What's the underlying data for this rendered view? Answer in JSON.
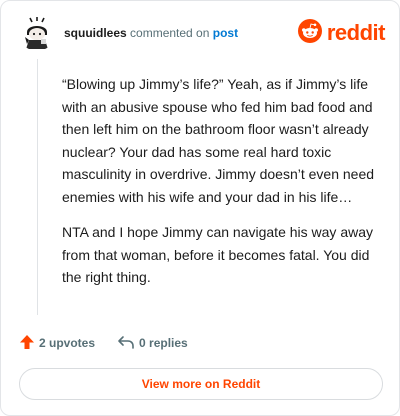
{
  "header": {
    "username": "squuidlees",
    "commented_text": "commented on",
    "post_link": "post",
    "brand_name": "reddit",
    "brand_color": "#ff4500",
    "avatar_icon": "chibi-character-avatar-icon",
    "logo_icon": "reddit-snoo-icon"
  },
  "comment": {
    "paragraphs": [
      "“Blowing up Jimmy’s life?” Yeah, as if Jimmy’s life with an abusive spouse who fed him bad food and then left him on the bathroom floor wasn’t already nuclear? Your dad has some real hard toxic masculinity in overdrive. Jimmy doesn’t even need enemies with his wife and your dad in his life…",
      "NTA and I hope Jimmy can navigate his way away from that woman, before it becomes fatal. You did the right thing."
    ]
  },
  "actions": {
    "upvotes_label": "2 upvotes",
    "replies_label": "0 replies",
    "upvote_icon": "upvote-arrow-icon",
    "reply_icon": "reply-arrow-icon",
    "upvote_color": "#ff4500"
  },
  "footer": {
    "view_more_label": "View more on Reddit"
  }
}
